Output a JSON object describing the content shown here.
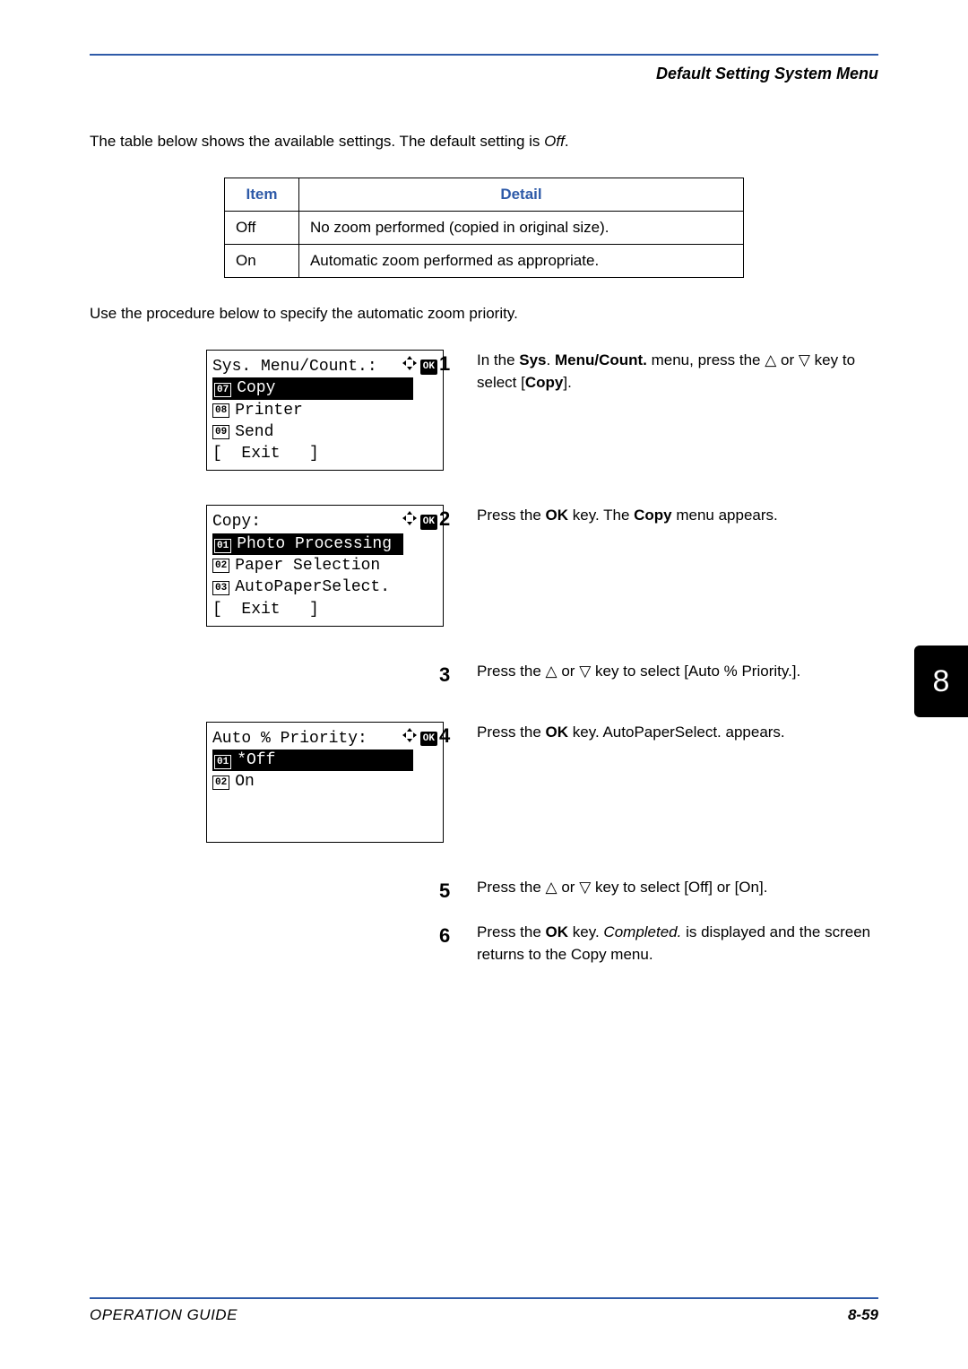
{
  "header": {
    "title": "Default Setting System Menu"
  },
  "intro": {
    "prefix": "The table below shows the available settings. The default setting is ",
    "italic": "Off",
    "suffix": "."
  },
  "table": {
    "head": {
      "item": "Item",
      "detail": "Detail"
    },
    "rows": [
      {
        "item": "Off",
        "detail": "No zoom performed (copied in original size)."
      },
      {
        "item": "On",
        "detail": "Automatic zoom performed as appropriate."
      }
    ]
  },
  "procedure": "Use the procedure below to specify the automatic zoom priority.",
  "lcd1": {
    "title": "Sys. Menu/Count.:",
    "ok": "OK",
    "rows": [
      {
        "num": "07",
        "label": "Copy",
        "selected": true
      },
      {
        "num": "08",
        "label": "Printer",
        "selected": false
      },
      {
        "num": "09",
        "label": "Send",
        "selected": false
      }
    ],
    "exit": "[  Exit   ]"
  },
  "lcd2": {
    "title": "Copy:",
    "ok": "OK",
    "rows": [
      {
        "num": "01",
        "label": "Photo Processing",
        "selected": true
      },
      {
        "num": "02",
        "label": "Paper Selection",
        "selected": false
      },
      {
        "num": "03",
        "label": "AutoPaperSelect.",
        "selected": false
      }
    ],
    "exit": "[  Exit   ]"
  },
  "lcd3": {
    "title": "Auto % Priority:",
    "ok": "OK",
    "rows": [
      {
        "num": "01",
        "label": "*Off",
        "selected": true
      },
      {
        "num": "02",
        "label": "On",
        "selected": false
      }
    ]
  },
  "steps": {
    "s1": {
      "n": "1",
      "t1": "In the ",
      "b1": "Sys",
      "t2": ". ",
      "b2": "Menu/Count.",
      "t3": " menu, press the ",
      "tri_up": "△",
      "t4": " or ",
      "tri_dn": "▽",
      "t5": " key to select [",
      "b3": "Copy",
      "t6": "]."
    },
    "s2": {
      "n": "2",
      "t1": "Press the ",
      "b1": "OK",
      "t2": " key. The ",
      "b2": "Copy",
      "t3": " menu appears."
    },
    "s3": {
      "n": "3",
      "t1": "Press the ",
      "tri_up": "△",
      "t2": " or ",
      "tri_dn": "▽",
      "t3": " key to select [Auto % Priority.]."
    },
    "s4": {
      "n": "4",
      "t1": "Press the ",
      "b1": "OK",
      "t2": " key. AutoPaperSelect. appears."
    },
    "s5": {
      "n": "5",
      "t1": "Press the ",
      "tri_up": "△",
      "t2": " or ",
      "tri_dn": "▽",
      "t3": " key to select [Off] or [On]."
    },
    "s6": {
      "n": "6",
      "t1": "Press the ",
      "b1": "OK",
      "t2": " key. ",
      "i1": "Completed.",
      "t3": " is displayed and the screen returns to the Copy menu."
    }
  },
  "side_tab": "8",
  "footer": {
    "left": "OPERATION GUIDE",
    "right": "8-59"
  }
}
